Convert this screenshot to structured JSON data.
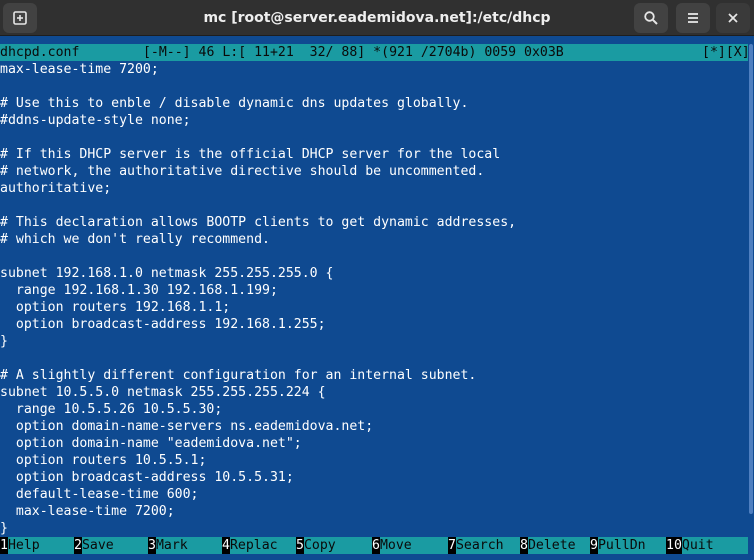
{
  "window": {
    "title": "mc [root@server.eademidova.net]:/etc/dhcp"
  },
  "headerbar": {
    "new_tab_icon": "new-tab-icon",
    "search_icon": "search-icon",
    "menu_icon": "hamburger-menu-icon",
    "close_icon": "close-icon"
  },
  "editor": {
    "status": {
      "filename": "dhcpd.conf",
      "info": "[-M--] 46 L:[ 11+21  32/ 88] *(921 /2704b) 0059 0x03B",
      "flags": "[*][X]"
    },
    "lines": [
      "max-lease-time 7200;",
      "",
      "# Use this to enble / disable dynamic dns updates globally.",
      "#ddns-update-style none;",
      "",
      "# If this DHCP server is the official DHCP server for the local",
      "# network, the authoritative directive should be uncommented.",
      "authoritative;",
      "",
      "# This declaration allows BOOTP clients to get dynamic addresses,",
      "# which we don't really recommend.",
      "",
      "subnet 192.168.1.0 netmask 255.255.255.0 {",
      "  range 192.168.1.30 192.168.1.199;",
      "  option routers 192.168.1.1;",
      "  option broadcast-address 192.168.1.255;",
      "}",
      "",
      "# A slightly different configuration for an internal subnet.",
      "subnet 10.5.5.0 netmask 255.255.255.224 {",
      "  range 10.5.5.26 10.5.5.30;",
      "  option domain-name-servers ns.eademidova.net;",
      "  option domain-name \"eademidova.net\";",
      "  option routers 10.5.5.1;",
      "  option broadcast-address 10.5.5.31;",
      "  default-lease-time 600;",
      "  max-lease-time 7200;",
      "}"
    ]
  },
  "fkeys": [
    {
      "num": "1",
      "label": "Help"
    },
    {
      "num": "2",
      "label": "Save"
    },
    {
      "num": "3",
      "label": "Mark"
    },
    {
      "num": "4",
      "label": "Replac"
    },
    {
      "num": "5",
      "label": "Copy"
    },
    {
      "num": "6",
      "label": "Move"
    },
    {
      "num": "7",
      "label": "Search"
    },
    {
      "num": "8",
      "label": "Delete"
    },
    {
      "num": "9",
      "label": "PullDn"
    },
    {
      "num": "10",
      "label": "Quit"
    }
  ],
  "colors": {
    "editor_bg": "#0f4a91",
    "status_bg": "#1a9ba2",
    "headerbar_bg": "#303030",
    "text": "#ffffff"
  }
}
